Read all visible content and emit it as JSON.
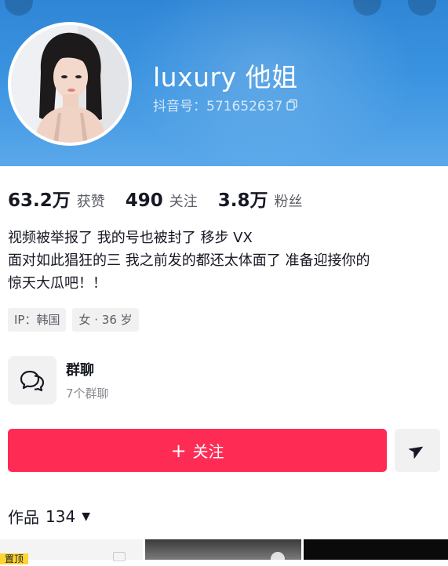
{
  "profile": {
    "username": "luxury 他姐",
    "douyin_id": "抖音号：571652637"
  },
  "stats": [
    {
      "value": "63.2万",
      "label": "获赞"
    },
    {
      "value": "490",
      "label": "关注"
    },
    {
      "value": "3.8万",
      "label": "粉丝"
    }
  ],
  "bio": {
    "line1": "视频被举报了 我的号也被封了  移步 VX",
    "line2": "面对如此猖狂的三 我之前发的都还太体面了 准备迎接你的",
    "line3": "惊天大瓜吧！！"
  },
  "tags": {
    "ip": "IP：韩国",
    "gender_age": "女 · 36 岁"
  },
  "group": {
    "title": "群聊",
    "subtitle": "7个群聊"
  },
  "actions": {
    "follow_label": "关注",
    "follow_prefix": "+"
  },
  "works": {
    "label": "作品",
    "count": "134"
  },
  "grid": {
    "pinned_label": "置顶"
  },
  "colors": {
    "header_blue": "#3a93e0",
    "follow_red": "#fe2c55",
    "pin_yellow": "#fcd535"
  }
}
